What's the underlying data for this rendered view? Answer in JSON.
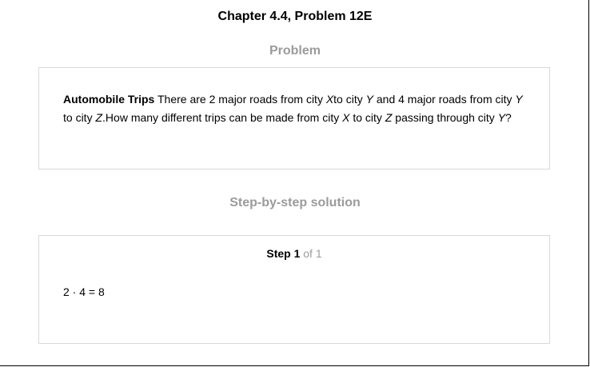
{
  "header": {
    "title": "Chapter 4.4, Problem 12E"
  },
  "problem": {
    "heading": "Problem",
    "label": "Automobile Trips",
    "seg1": " There are 2 major roads from city ",
    "city_x": "X",
    "seg2": "to city ",
    "city_y": "Y",
    "seg3": " and 4 major roads from city ",
    "seg4": " to city ",
    "city_z": "Z",
    "seg5": ".How many different trips can be made from city ",
    "seg6": " to city ",
    "seg7": " passing through city ",
    "end_punct": "?"
  },
  "solution": {
    "heading": "Step-by-step solution",
    "step_label": "Step 1",
    "step_of": " of 1",
    "content": "2 · 4 = 8"
  }
}
